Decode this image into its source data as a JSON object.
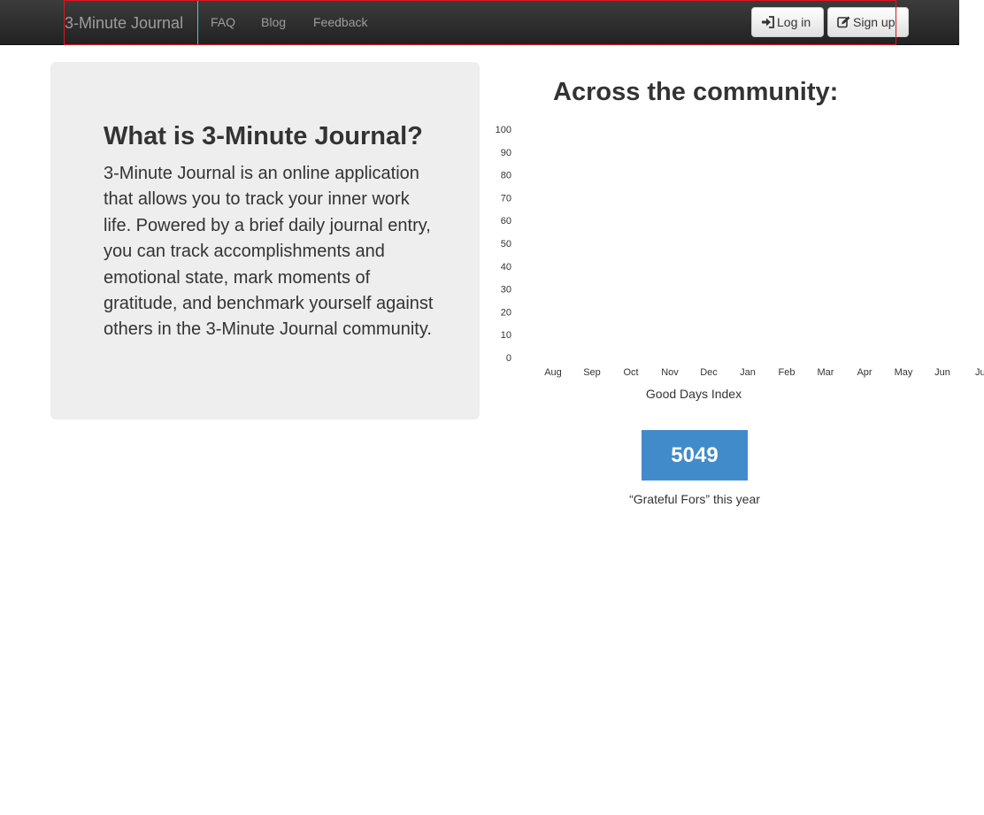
{
  "navbar": {
    "brand": "3-Minute Journal",
    "links": [
      "FAQ",
      "Blog",
      "Feedback"
    ],
    "login_label": "Log in",
    "signup_label": "Sign up"
  },
  "intro": {
    "heading": "What is 3-Minute Journal?",
    "body": "3-Minute Journal is an online application that allows you to track your inner work life. Powered by a brief daily journal entry, you can track accomplishments and emotional state, mark moments of gratitude, and benchmark yourself against others in the 3-Minute Journal community."
  },
  "community": {
    "heading": "Across the community:",
    "stat_value": "5049",
    "stat_caption": "“Grateful Fors” this year"
  },
  "chart_data": {
    "type": "line",
    "categories": [
      "Aug",
      "Sep",
      "Oct",
      "Nov",
      "Dec",
      "Jan",
      "Feb",
      "Mar",
      "Apr",
      "May",
      "Jun",
      "Jul"
    ],
    "yticks": [
      "100",
      "90",
      "80",
      "70",
      "60",
      "50",
      "40",
      "30",
      "20",
      "10",
      "0"
    ],
    "ylim": [
      0,
      100
    ],
    "xlabel": "Good Days Index",
    "series": []
  }
}
